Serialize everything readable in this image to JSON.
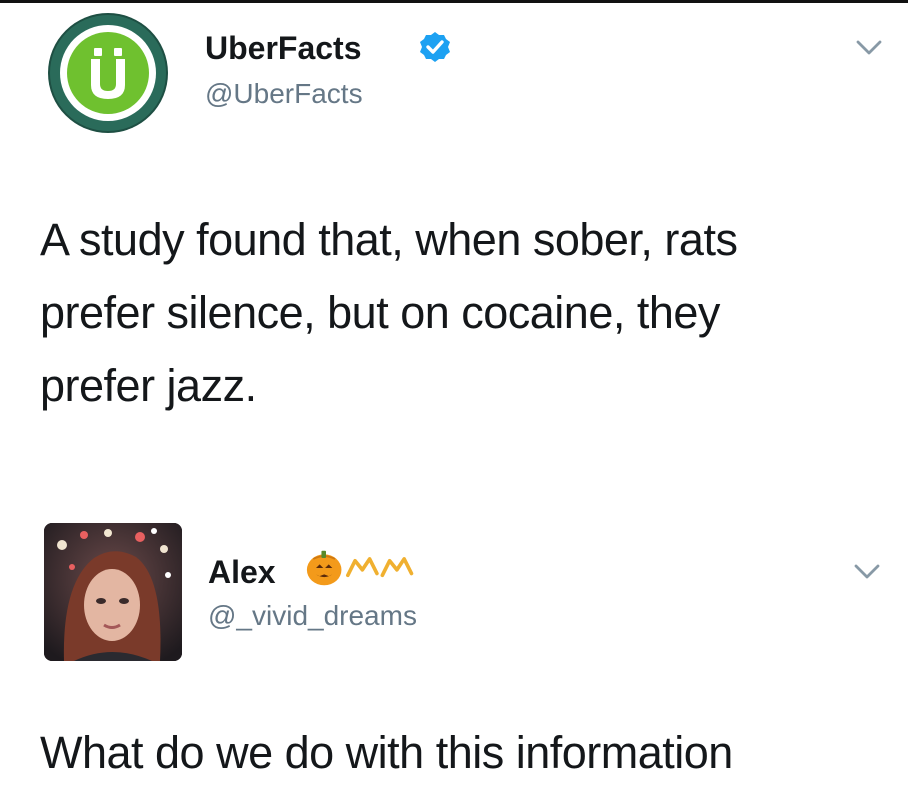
{
  "tweets": [
    {
      "author": {
        "display_name": "UberFacts",
        "handle": "@UberFacts",
        "verified": true,
        "avatar_icon": "uberfacts-logo-icon",
        "avatar_letter": "Ü"
      },
      "text_lines": [
        "A study found that, when sober, rats",
        "prefer silence, but on cocaine, they",
        "prefer jazz."
      ],
      "menu_icon": "chevron-down-icon"
    },
    {
      "author": {
        "display_name": "Alex",
        "handle": "@_vivid_dreams",
        "verified": false,
        "avatar_icon": "profile-photo",
        "name_emojis": [
          "jack-o-lantern-icon",
          "crown-icon",
          "crown-icon"
        ]
      },
      "text_lines": [
        "What do we do with this information"
      ],
      "menu_icon": "chevron-down-icon"
    }
  ],
  "colors": {
    "text": "#14171a",
    "handle": "#657786",
    "verified_blue": "#1da1f2",
    "uber_green": "#6fc12f",
    "uber_ring": "#2a6b5a"
  }
}
